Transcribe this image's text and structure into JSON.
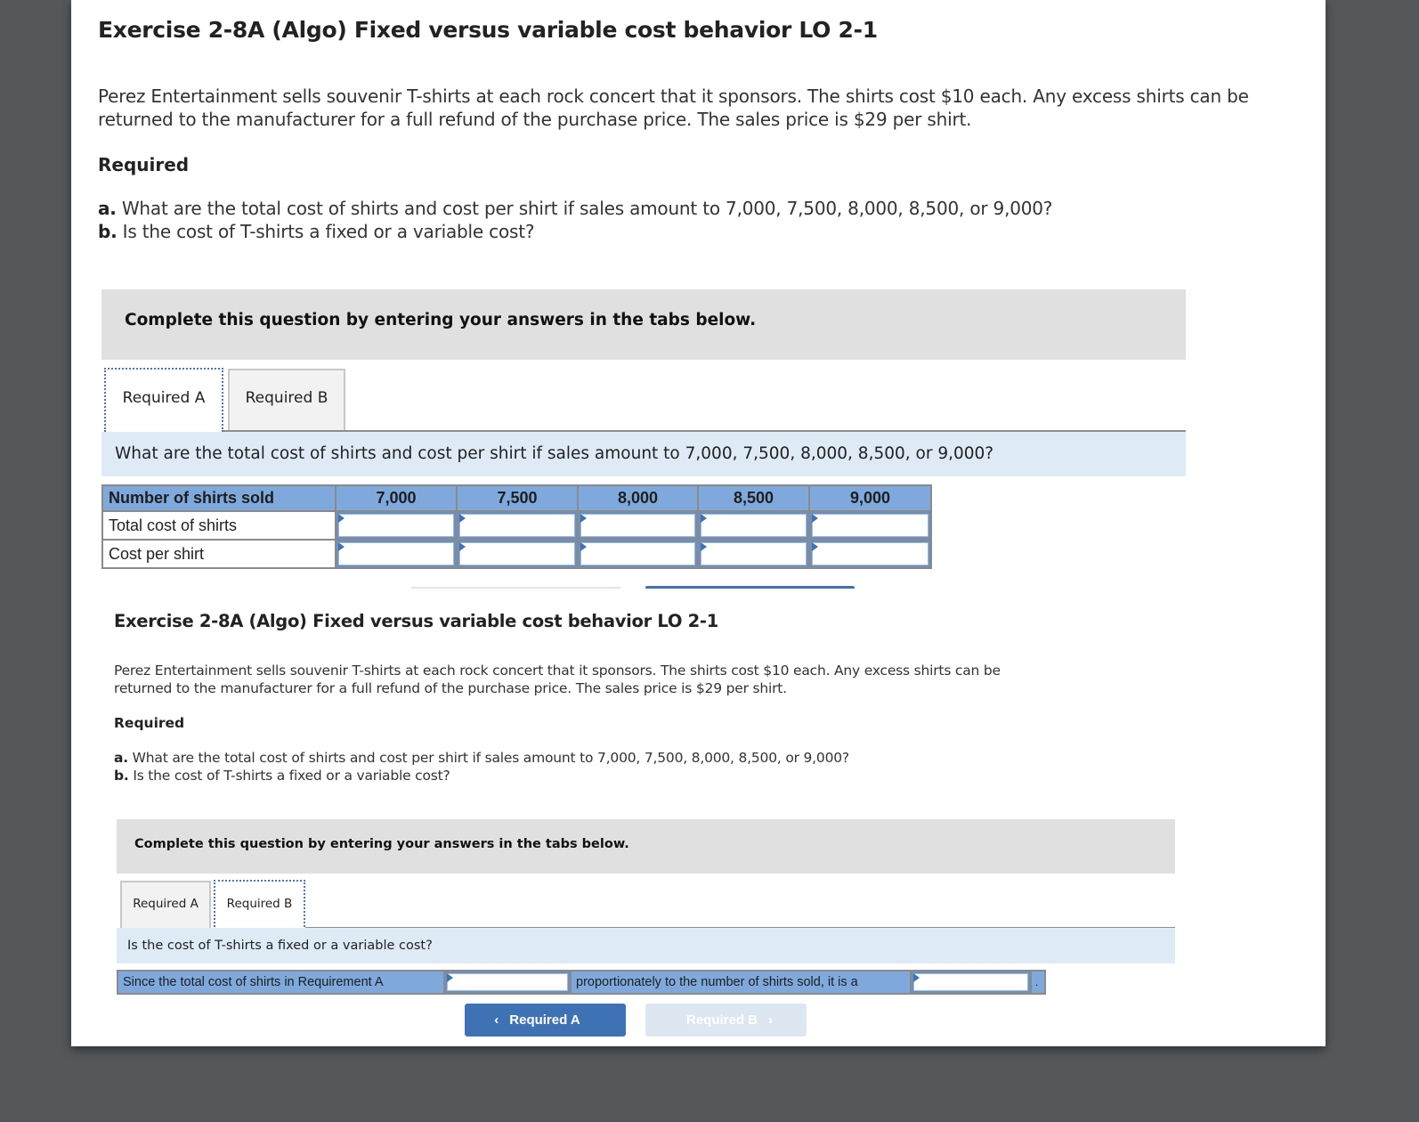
{
  "section1": {
    "title": "Exercise 2-8A (Algo) Fixed versus variable cost behavior LO 2-1",
    "paragraph": "Perez Entertainment sells souvenir T-shirts at each rock concert that it sponsors. The shirts cost $10 each. Any excess shirts can be returned to the manufacturer for a full refund of the purchase price. The sales price is $29 per shirt.",
    "required_heading": "Required",
    "req_a_prefix": "a.",
    "req_a_text": " What are the total cost of shirts and cost per shirt if sales amount to 7,000, 7,500, 8,000, 8,500, or 9,000?",
    "req_b_prefix": "b.",
    "req_b_text": " Is the cost of T-shirts a fixed or a variable cost?",
    "instructions": "Complete this question by entering your answers in the tabs below.",
    "tabs": [
      {
        "label": "Required A",
        "active": true
      },
      {
        "label": "Required B",
        "active": false
      }
    ],
    "question": "What are the total cost of shirts and cost per shirt if sales amount to 7,000, 7,500, 8,000, 8,500, or 9,000?",
    "table": {
      "row_header": "Number of shirts sold",
      "columns": [
        "7,000",
        "7,500",
        "8,000",
        "8,500",
        "9,000"
      ],
      "rows": [
        {
          "label": "Total cost of shirts",
          "values": [
            "",
            "",
            "",
            "",
            ""
          ]
        },
        {
          "label": "Cost per shirt",
          "values": [
            "",
            "",
            "",
            "",
            ""
          ]
        }
      ]
    }
  },
  "section2": {
    "title": "Exercise 2-8A (Algo) Fixed versus variable cost behavior LO 2-1",
    "paragraph": "Perez Entertainment sells souvenir T-shirts at each rock concert that it sponsors. The shirts cost $10 each. Any excess shirts can be returned to the manufacturer for a full refund of the purchase price. The sales price is $29 per shirt.",
    "required_heading": "Required",
    "req_a_prefix": "a.",
    "req_a_text": " What are the total cost of shirts and cost per shirt if sales amount to 7,000, 7,500, 8,000, 8,500, or 9,000?",
    "req_b_prefix": "b.",
    "req_b_text": " Is the cost of T-shirts a fixed or a variable cost?",
    "instructions": "Complete this question by entering your answers in the tabs below.",
    "tabs": [
      {
        "label": "Required A",
        "active": false
      },
      {
        "label": "Required B",
        "active": true
      }
    ],
    "question": "Is the cost of T-shirts a fixed or a variable cost?",
    "sentence": {
      "part1": "Since the total cost of shirts in Requirement A",
      "input1_value": "",
      "part2": "proportionately to the number of shirts sold, it is a",
      "input2_value": "",
      "end": "."
    },
    "nav": {
      "prev_label": "Required A",
      "prev_icon": "chevron-left-icon",
      "next_label": "Required B",
      "next_icon": "chevron-right-icon",
      "next_disabled": true
    }
  },
  "colors": {
    "background": "#54585b",
    "header_blue": "#7fa9dc",
    "info_bar": "#deebf7",
    "instruction_grey": "#e0e0e0",
    "button_blue": "#3f72b5",
    "button_disabled": "#dde7f2"
  }
}
